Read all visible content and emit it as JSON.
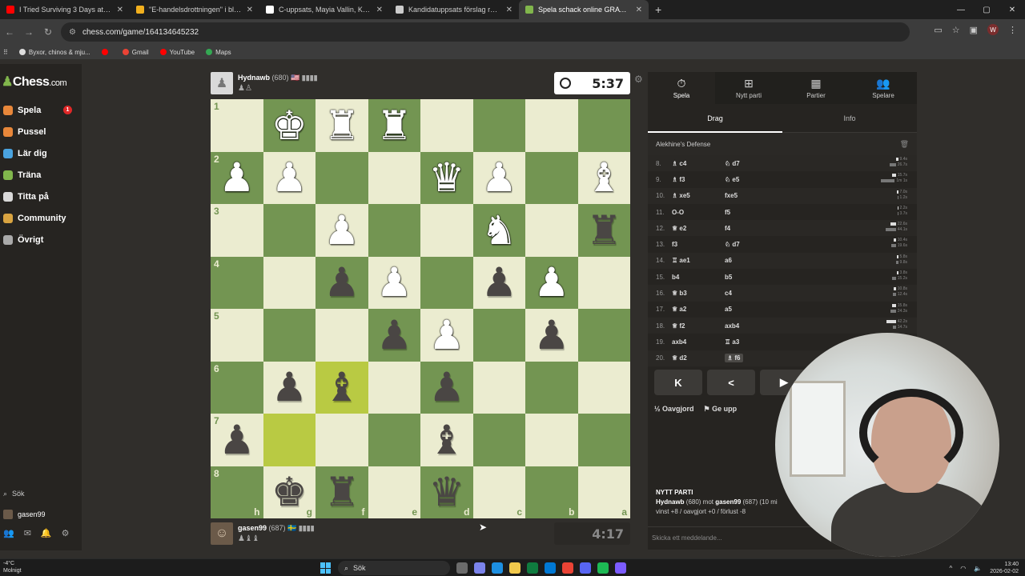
{
  "browser": {
    "tabs": [
      {
        "title": "I Tried Surviving 3 Days at the S",
        "color": "#ff0000",
        "active": false
      },
      {
        "title": "\"E-handelsdrottningen\" i blåsvä",
        "color": "#f2b01e",
        "active": false
      },
      {
        "title": "C-uppsats, Mayia Vallin, Kriskom",
        "color": "#ffffff",
        "active": false
      },
      {
        "title": "Kandidatuppsats förslag retorik",
        "color": "#cccccc",
        "active": false
      },
      {
        "title": "Spela schack online GRATIS – tä",
        "color": "#81b64c",
        "active": true
      }
    ],
    "url": "chess.com/game/164134645232",
    "profile_initial": "W",
    "bookmarks": [
      {
        "label": "Byxor, chinos & mju...",
        "color": "#dddddd"
      },
      {
        "label": "",
        "color": "#ff0000"
      },
      {
        "label": "Gmail",
        "color": "#ea4335"
      },
      {
        "label": "YouTube",
        "color": "#ff0000"
      },
      {
        "label": "Maps",
        "color": "#34a853"
      }
    ]
  },
  "sidebar": {
    "logo": "Chess",
    "logo_suffix": ".com",
    "items": [
      {
        "label": "Spela",
        "icon": "pawn-play-icon",
        "color": "#e8873a",
        "badge": "1"
      },
      {
        "label": "Pussel",
        "icon": "puzzle-icon",
        "color": "#e8873a"
      },
      {
        "label": "Lär dig",
        "icon": "learn-icon",
        "color": "#4aa3df"
      },
      {
        "label": "Träna",
        "icon": "train-icon",
        "color": "#81b64c"
      },
      {
        "label": "Titta på",
        "icon": "watch-icon",
        "color": "#d9d9d9"
      },
      {
        "label": "Community",
        "icon": "community-icon",
        "color": "#d9a441"
      },
      {
        "label": "Övrigt",
        "icon": "more-icon",
        "color": "#aaaaaa"
      }
    ],
    "search_label": "Sök",
    "username": "gasen99"
  },
  "top_player": {
    "name": "Hydnawb",
    "rating": "(680)",
    "flag": "🇺🇸",
    "clock": "5:37",
    "captured": "♟♙"
  },
  "bottom_player": {
    "name": "gasen99",
    "rating": "(687)",
    "flag": "🇸🇪",
    "clock": "4:17",
    "captured": "♟♝♝"
  },
  "board": {
    "ranks": [
      "1",
      "2",
      "3",
      "4",
      "5",
      "6",
      "7",
      "8"
    ],
    "files": [
      "h",
      "g",
      "f",
      "e",
      "d",
      "c",
      "b",
      "a"
    ],
    "pieces": [
      [
        "",
        "wK",
        "wR",
        "wR",
        "",
        "",
        "",
        ""
      ],
      [
        "wP",
        "wP",
        "",
        "",
        "wQ",
        "wP",
        "",
        "wB"
      ],
      [
        "",
        "",
        "wP",
        "",
        "",
        "wN",
        "",
        "bR"
      ],
      [
        "",
        "",
        "bP",
        "wP",
        "",
        "bP",
        "wP",
        ""
      ],
      [
        "",
        "",
        "",
        "bP",
        "wP",
        "",
        "bP",
        ""
      ],
      [
        "",
        "bP",
        "bB",
        "",
        "bP",
        "",
        "",
        ""
      ],
      [
        "bP",
        "",
        "",
        "",
        "bB",
        "",
        "",
        ""
      ],
      [
        "",
        "bK",
        "bR",
        "",
        "bQ",
        "",
        "",
        ""
      ]
    ],
    "highlights": [
      [
        5,
        2
      ],
      [
        6,
        1
      ]
    ]
  },
  "panel": {
    "tabs": [
      {
        "label": "Spela",
        "icon": "stopwatch-icon",
        "active": true
      },
      {
        "label": "Nytt parti",
        "icon": "plus-icon",
        "active": false
      },
      {
        "label": "Partier",
        "icon": "board-icon",
        "active": false
      },
      {
        "label": "Spelare",
        "icon": "players-icon",
        "active": false
      }
    ],
    "subtabs": [
      {
        "label": "Drag",
        "active": true
      },
      {
        "label": "Info",
        "active": false
      }
    ],
    "opening": "Alekhine's Defense",
    "moves": [
      {
        "n": "8.",
        "w": "♗ c4",
        "b": "♘ d7",
        "wt": "9.4s",
        "bt": "26.7s"
      },
      {
        "n": "9.",
        "w": "♗ f3",
        "b": "♘ e5",
        "wt": "15.7s",
        "bt": "1m 1s"
      },
      {
        "n": "10.",
        "w": "♗ xe5",
        "b": "fxe5",
        "wt": "7.0s",
        "bt": "1.2s"
      },
      {
        "n": "11.",
        "w": "O-O",
        "b": "f5",
        "wt": "2.2s",
        "bt": "3.7s"
      },
      {
        "n": "12.",
        "w": "♕ e2",
        "b": "f4",
        "wt": "22.6s",
        "bt": "44.1s"
      },
      {
        "n": "13.",
        "w": "f3",
        "b": "♘ d7",
        "wt": "10.4s",
        "bt": "19.6s"
      },
      {
        "n": "14.",
        "w": "♖ ae1",
        "b": "a6",
        "wt": "5.8s",
        "bt": "9.8s"
      },
      {
        "n": "15.",
        "w": "b4",
        "b": "b5",
        "wt": "3.8s",
        "bt": "15.2s"
      },
      {
        "n": "16.",
        "w": "♕ b3",
        "b": "c4",
        "wt": "10.8s",
        "bt": "12.4s"
      },
      {
        "n": "17.",
        "w": "♕ a2",
        "b": "a5",
        "wt": "15.8s",
        "bt": "24.3s"
      },
      {
        "n": "18.",
        "w": "♕ f2",
        "b": "axb4",
        "wt": "42.2s",
        "bt": "14.7s"
      },
      {
        "n": "19.",
        "w": "axb4",
        "b": "♖ a3",
        "wt": "",
        "bt": ""
      },
      {
        "n": "20.",
        "w": "♕ d2",
        "b": "♗ f6",
        "wt": "",
        "bt": ""
      }
    ],
    "nav_first": "K",
    "nav_prev": "<",
    "nav_next": "▶",
    "draw_label": "Oavgjord",
    "draw_icon": "½",
    "resign_label": "Ge upp",
    "new_game_title": "NYTT PARTI",
    "new_game_players": "Hydnawb",
    "new_game_rest": " (680) mot ",
    "new_game_opp": "gasen99",
    "new_game_tail": " (687) (10 mi",
    "new_game_stats": "vinst +8 / oavgjort +0 / förlust -8",
    "message_placeholder": "Skicka ett meddelande..."
  },
  "taskbar": {
    "temp": "-4°C",
    "weather": "Molnigt",
    "search": "Sök",
    "time": "13:40",
    "date": "2026-02-02",
    "apps": [
      "#6b6b6b",
      "#7b83eb",
      "#1d8fe1",
      "#f2c94c",
      "#0f7b3f",
      "#0078d4",
      "#ea4335",
      "#5865f2",
      "#1db954",
      "#7c5cff"
    ]
  }
}
